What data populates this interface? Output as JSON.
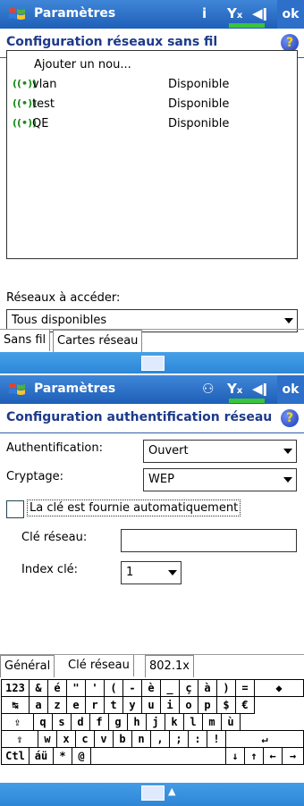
{
  "colors": {
    "titlebar": "#2a6fc9",
    "header_text": "#1d3a8a",
    "cmdbar": "#3594e0",
    "signal_icon": "#1c8b1c"
  },
  "screen1": {
    "title": "Paramètres",
    "ok": "ok",
    "header": "Configuration réseaux sans fil",
    "networks": [
      {
        "name": "Ajouter un nou...",
        "status": ""
      },
      {
        "name": "vlan",
        "status": "Disponible"
      },
      {
        "name": "test",
        "status": "Disponible"
      },
      {
        "name": "QE",
        "status": "Disponible"
      }
    ],
    "access_label": "Réseaux à accéder:",
    "access_value": "Tous disponibles",
    "tabs": [
      "Sans fil",
      "Cartes réseau"
    ]
  },
  "screen2": {
    "title": "Paramètres",
    "ok": "ok",
    "header": "Configuration authentification réseau",
    "auth_label": "Authentification:",
    "auth_value": "Ouvert",
    "crypt_label": "Cryptage:",
    "crypt_value": "WEP",
    "auto_key_label": "La clé est fournie automatiquement",
    "auto_key_checked": false,
    "key_label": "Clé réseau:",
    "key_value": "",
    "index_label": "Index clé:",
    "index_value": "1",
    "tabs": [
      "Général",
      "Clé réseau",
      "802.1x"
    ]
  },
  "keyboard": {
    "rows": [
      [
        "123",
        "&",
        "é",
        "\"",
        "'",
        "(",
        "-",
        "è",
        "_",
        "ç",
        "à",
        ")",
        "=",
        "◆"
      ],
      [
        "↹",
        "a",
        "z",
        "e",
        "r",
        "t",
        "y",
        "u",
        "i",
        "o",
        "p",
        "$",
        "€"
      ],
      [
        "⇪",
        "q",
        "s",
        "d",
        "f",
        "g",
        "h",
        "j",
        "k",
        "l",
        "m",
        "ù"
      ],
      [
        "⇧",
        "w",
        "x",
        "c",
        "v",
        "b",
        "n",
        ",",
        ";",
        ":",
        "!",
        "↵"
      ],
      [
        "Ctl",
        "áü",
        "*",
        "@",
        " ",
        "↓",
        "↑",
        "←",
        "→"
      ]
    ]
  }
}
